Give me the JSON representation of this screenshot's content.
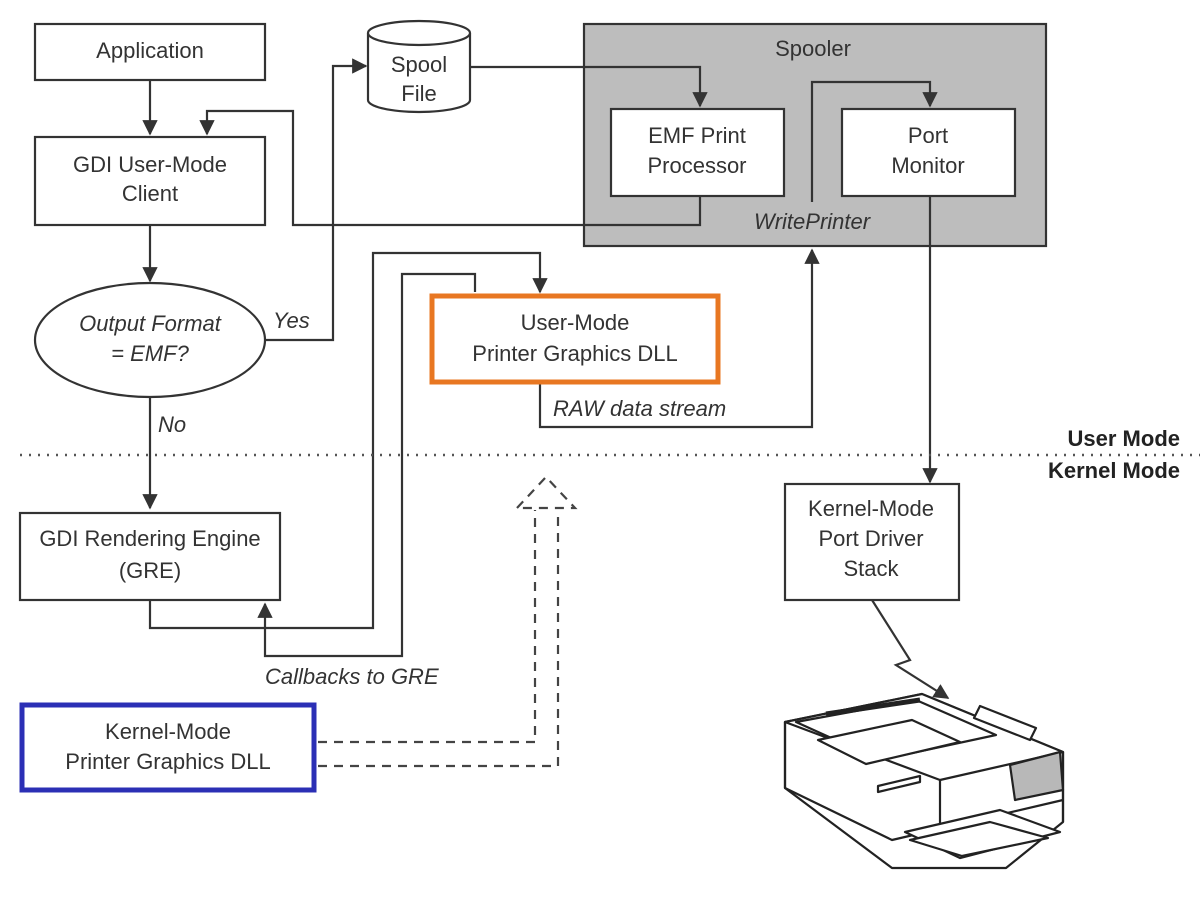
{
  "diagram": {
    "nodes": {
      "application": {
        "lines": [
          "Application"
        ]
      },
      "gdi_client": {
        "lines": [
          "GDI User-Mode",
          "Client"
        ]
      },
      "decision": {
        "lines": [
          "Output Format",
          "= EMF?"
        ]
      },
      "spool_file": {
        "lines": [
          "Spool",
          "File"
        ]
      },
      "spooler": {
        "title": "Spooler"
      },
      "emf_processor": {
        "lines": [
          "EMF Print",
          "Processor"
        ]
      },
      "port_monitor": {
        "lines": [
          "Port",
          "Monitor"
        ]
      },
      "user_dll": {
        "lines": [
          "User-Mode",
          "Printer Graphics DLL"
        ]
      },
      "gre": {
        "lines": [
          "GDI Rendering Engine",
          "(GRE)"
        ]
      },
      "kernel_dll": {
        "lines": [
          "Kernel-Mode",
          "Printer Graphics DLL"
        ]
      },
      "port_driver": {
        "lines": [
          "Kernel-Mode",
          "Port Driver",
          "Stack"
        ]
      },
      "printer": {
        "icon": "printer-icon"
      }
    },
    "edge_labels": {
      "yes": "Yes",
      "no": "No",
      "write_printer": "WritePrinter",
      "raw_stream": "RAW data stream",
      "callbacks": "Callbacks to GRE"
    },
    "boundary": {
      "upper": "User Mode",
      "lower": "Kernel Mode"
    },
    "colors": {
      "user_dll_border": "#e87722",
      "kernel_dll_border": "#2b2fb5",
      "spooler_fill": "#bdbdbd",
      "printer_panel": "#b8b8b8"
    }
  }
}
